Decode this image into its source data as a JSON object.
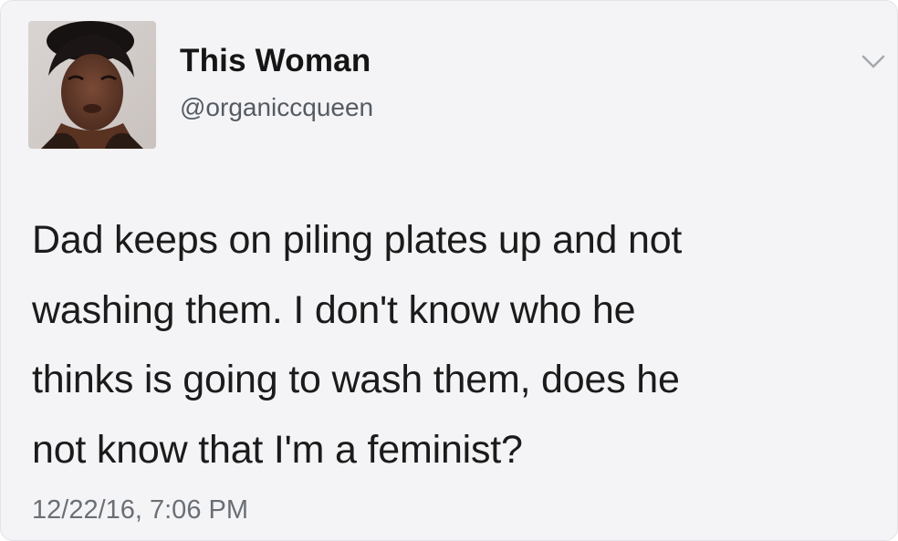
{
  "tweet": {
    "author": {
      "display_name": "This Woman",
      "handle": "@organiccqueen",
      "avatar": "profile-photo"
    },
    "menu_icon": "chevron-down-icon",
    "text_lines": [
      "Dad keeps on piling plates up and not",
      "washing them. I don't  know who he",
      "thinks is going to wash them, does he",
      "not know that I'm a feminist?"
    ],
    "timestamp": "12/22/16, 7:06 PM"
  },
  "colors": {
    "background": "#f4f4f6",
    "text": "#1b1b1b",
    "secondary_text": "#6a6f76"
  }
}
